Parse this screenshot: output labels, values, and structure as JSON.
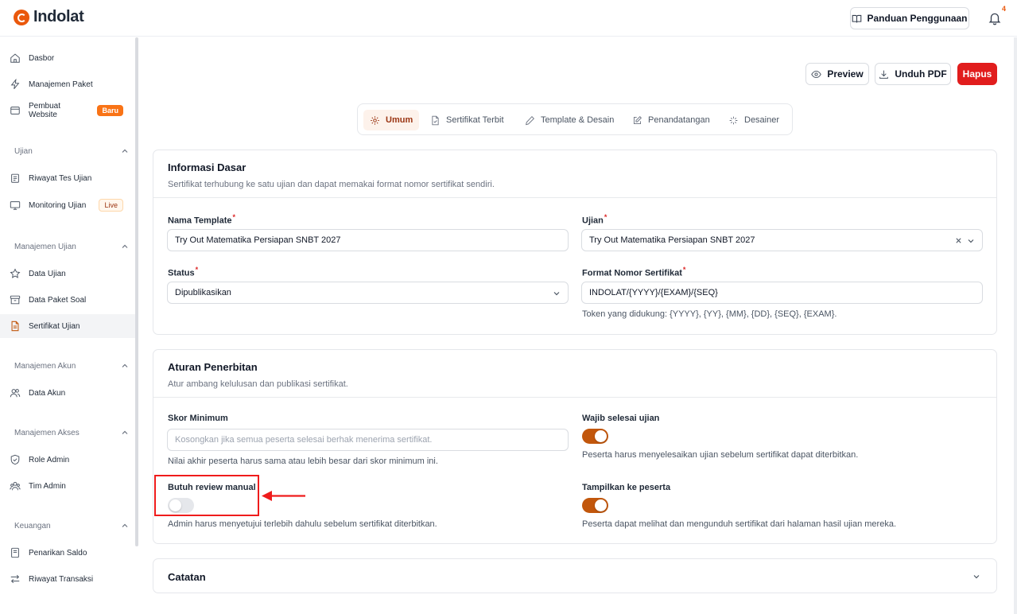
{
  "app": {
    "brand": "Indolat"
  },
  "header": {
    "guide_label": "Panduan Penggunaan",
    "notification_count": "4"
  },
  "sidebar": {
    "items": [
      {
        "label": "Dasbor"
      },
      {
        "label": "Manajemen Paket"
      },
      {
        "label": "Pembuat Website",
        "badge": "Baru"
      },
      {
        "label": "Riwayat Tes Ujian"
      },
      {
        "label": "Monitoring Ujian",
        "badge": "Live"
      },
      {
        "label": "Data Ujian"
      },
      {
        "label": "Data Paket Soal"
      },
      {
        "label": "Sertifikat Ujian"
      },
      {
        "label": "Data Akun"
      },
      {
        "label": "Role Admin"
      },
      {
        "label": "Tim Admin"
      },
      {
        "label": "Penarikan Saldo"
      },
      {
        "label": "Riwayat Transaksi"
      }
    ],
    "sections": [
      {
        "label": "Ujian"
      },
      {
        "label": "Manajemen Ujian"
      },
      {
        "label": "Manajemen Akun"
      },
      {
        "label": "Manajemen Akses"
      },
      {
        "label": "Keuangan"
      }
    ]
  },
  "toolbar": {
    "preview_label": "Preview",
    "download_label": "Unduh PDF",
    "delete_label": "Hapus"
  },
  "tabs": [
    {
      "label": "Umum"
    },
    {
      "label": "Sertifikat Terbit"
    },
    {
      "label": "Template & Desain"
    },
    {
      "label": "Penandatangan"
    },
    {
      "label": "Desainer"
    }
  ],
  "basic_info": {
    "title": "Informasi Dasar",
    "subtitle": "Sertifikat terhubung ke satu ujian dan dapat memakai format nomor sertifikat sendiri.",
    "template_name_label": "Nama Template",
    "template_name_value": "Try Out Matematika Persiapan SNBT 2027",
    "exam_label": "Ujian",
    "exam_value": "Try Out Matematika Persiapan SNBT 2027",
    "status_label": "Status",
    "status_value": "Dipublikasikan",
    "format_label": "Format Nomor Sertifikat",
    "format_value": "INDOLAT/{YYYY}/{EXAM}/{SEQ}",
    "format_help": "Token yang didukung: {YYYY}, {YY}, {MM}, {DD}, {SEQ}, {EXAM}."
  },
  "issuance": {
    "title": "Aturan Penerbitan",
    "subtitle": "Atur ambang kelulusan dan publikasi sertifikat.",
    "min_score_label": "Skor Minimum",
    "min_score_placeholder": "Kosongkan jika semua peserta selesai berhak menerima sertifikat.",
    "min_score_help": "Nilai akhir peserta harus sama atau lebih besar dari skor minimum ini.",
    "must_finish_label": "Wajib selesai ujian",
    "must_finish_on": true,
    "must_finish_help": "Peserta harus menyelesaikan ujian sebelum sertifikat dapat diterbitkan.",
    "manual_review_label": "Butuh review manual",
    "manual_review_on": false,
    "manual_review_help": "Admin harus menyetujui terlebih dahulu sebelum sertifikat diterbitkan.",
    "show_participant_label": "Tampilkan ke peserta",
    "show_participant_on": true,
    "show_participant_help": "Peserta dapat melihat dan mengunduh sertifikat dari halaman hasil ujian mereka."
  },
  "notes": {
    "title": "Catatan"
  },
  "colors": {
    "accent": "#c2570c",
    "danger": "#e11d1d",
    "annotation": "#ef1c1c"
  }
}
